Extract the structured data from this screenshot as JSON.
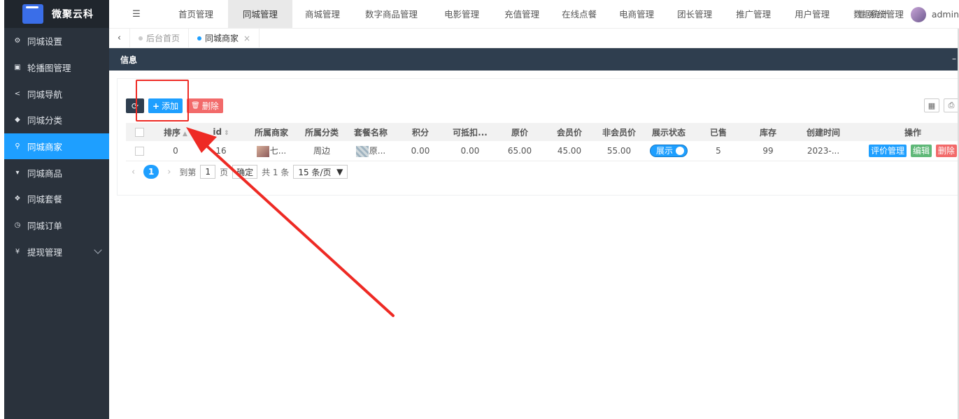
{
  "app": {
    "logo_text": "微聚云科"
  },
  "sidebar": {
    "items": [
      {
        "icon": "gear-icon",
        "glyph": "⚙",
        "label": "同城设置"
      },
      {
        "icon": "image-icon",
        "glyph": "▣",
        "label": "轮播图管理"
      },
      {
        "icon": "share-icon",
        "glyph": "<",
        "label": "同城导航"
      },
      {
        "icon": "tag-icon",
        "glyph": "◆",
        "label": "同城分类"
      },
      {
        "icon": "location-pin-icon",
        "glyph": "⚲",
        "label": "同城商家",
        "active": true
      },
      {
        "icon": "cart-icon",
        "glyph": "▾",
        "label": "同城商品"
      },
      {
        "icon": "cubes-icon",
        "glyph": "❖",
        "label": "同城套餐"
      },
      {
        "icon": "clock-icon",
        "glyph": "◷",
        "label": "同城订单"
      },
      {
        "icon": "yen-icon",
        "glyph": "¥",
        "label": "提现管理",
        "has_children": true
      }
    ]
  },
  "topnav": {
    "tabs": [
      "首页管理",
      "同城管理",
      "商城管理",
      "数字商品管理",
      "电影管理",
      "充值管理",
      "在线点餐",
      "电商管理",
      "团长管理",
      "推广管理",
      "用户管理",
      "数据统计"
    ],
    "active_index": 1,
    "system_label": "系统管理",
    "user_name": "admin"
  },
  "tabbar": {
    "tabs": [
      {
        "label": "后台首页",
        "current": false
      },
      {
        "label": "同城商家",
        "current": true
      }
    ]
  },
  "panel": {
    "title": "信息",
    "collapse_label": "–"
  },
  "toolbar": {
    "add_label": "添加",
    "delete_label": "删除"
  },
  "table": {
    "columns": [
      "排序",
      "id",
      "所属商家",
      "所属分类",
      "套餐名称",
      "积分",
      "可抵扣...",
      "原价",
      "会员价",
      "非会员价",
      "展示状态",
      "已售",
      "库存",
      "创建时间",
      "操作"
    ],
    "rows": [
      {
        "sort": "0",
        "id": "16",
        "merchant": "七...",
        "category": "周边",
        "package_name": "原...",
        "points": "0.00",
        "deductible": "0.00",
        "original_price": "65.00",
        "member_price": "45.00",
        "non_member_price": "55.00",
        "status_label": "展示",
        "status_on": true,
        "sold": "5",
        "stock": "99",
        "created": "2023-...",
        "actions": [
          "评价管理",
          "编辑",
          "删除"
        ]
      }
    ]
  },
  "pagination": {
    "current_page": "1",
    "goto_label": "到第",
    "page_input": "1",
    "page_suffix": "页",
    "confirm_label": "确定",
    "total_label": "共 1 条",
    "page_size": "15 条/页"
  },
  "colors": {
    "accent": "#1e9fff",
    "sidebar_bg": "#2a323c",
    "annotation_red": "#ee2a24"
  }
}
